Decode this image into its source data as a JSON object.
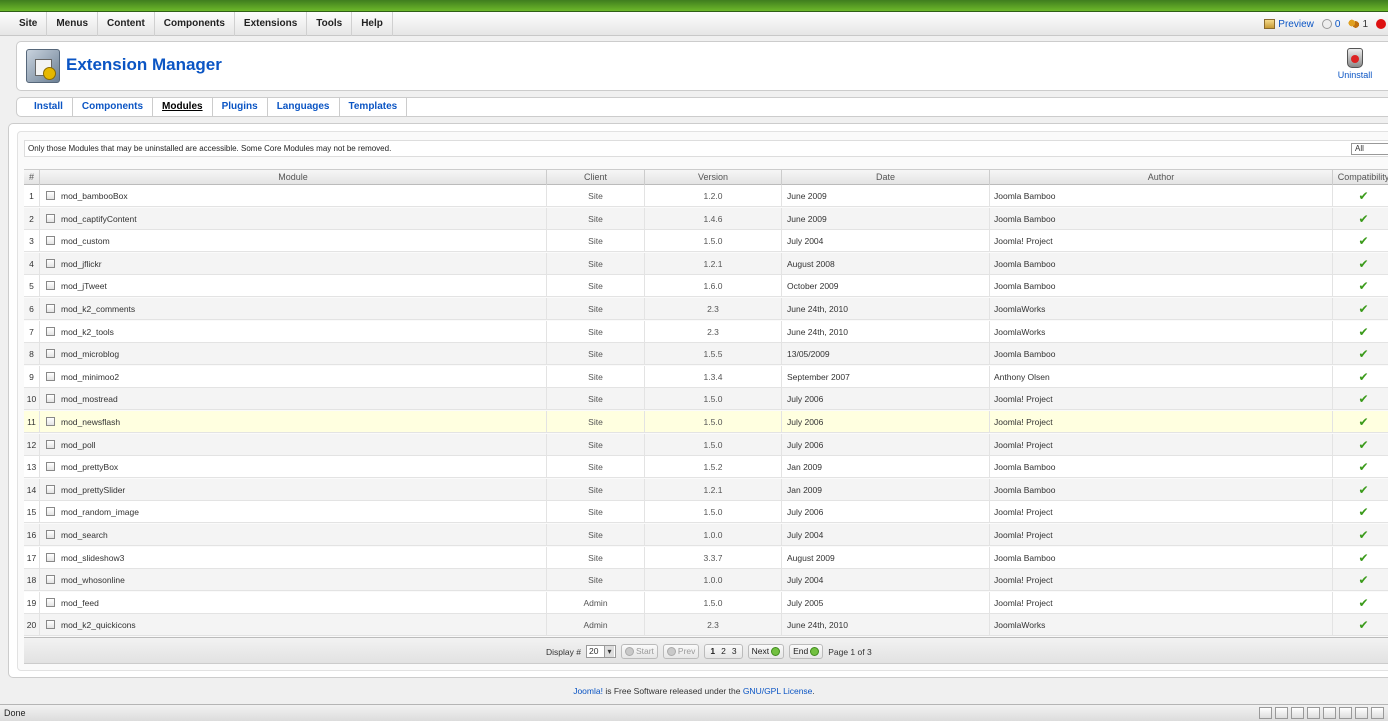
{
  "menu": [
    "Site",
    "Menus",
    "Content",
    "Components",
    "Extensions",
    "Tools",
    "Help"
  ],
  "status": {
    "preview": "Preview",
    "messages": "0",
    "users": "1"
  },
  "page_title": "Extension Manager",
  "toolbar": {
    "uninstall": "Uninstall"
  },
  "submenu": [
    "Install",
    "Components",
    "Modules",
    "Plugins",
    "Languages",
    "Templates"
  ],
  "active_submenu": "Modules",
  "notice": "Only those Modules that may be uninstalled are accessible. Some Core Modules may not be removed.",
  "filter": {
    "value": "All"
  },
  "table": {
    "columns": [
      "#",
      "Module",
      "Client",
      "Version",
      "Date",
      "Author",
      "Compatibility"
    ],
    "rows": [
      {
        "num": "1",
        "module": "mod_bambooBox",
        "client": "Site",
        "version": "1.2.0",
        "date": "June 2009",
        "author": "Joomla Bamboo"
      },
      {
        "num": "2",
        "module": "mod_captifyContent",
        "client": "Site",
        "version": "1.4.6",
        "date": "June 2009",
        "author": "Joomla Bamboo"
      },
      {
        "num": "3",
        "module": "mod_custom",
        "client": "Site",
        "version": "1.5.0",
        "date": "July 2004",
        "author": "Joomla! Project"
      },
      {
        "num": "4",
        "module": "mod_jflickr",
        "client": "Site",
        "version": "1.2.1",
        "date": "August 2008",
        "author": "Joomla Bamboo"
      },
      {
        "num": "5",
        "module": "mod_jTweet",
        "client": "Site",
        "version": "1.6.0",
        "date": "October 2009",
        "author": "Joomla Bamboo"
      },
      {
        "num": "6",
        "module": "mod_k2_comments",
        "client": "Site",
        "version": "2.3",
        "date": "June 24th, 2010",
        "author": "JoomlaWorks"
      },
      {
        "num": "7",
        "module": "mod_k2_tools",
        "client": "Site",
        "version": "2.3",
        "date": "June 24th, 2010",
        "author": "JoomlaWorks"
      },
      {
        "num": "8",
        "module": "mod_microblog",
        "client": "Site",
        "version": "1.5.5",
        "date": "13/05/2009",
        "author": "Joomla Bamboo"
      },
      {
        "num": "9",
        "module": "mod_minimoo2",
        "client": "Site",
        "version": "1.3.4",
        "date": "September 2007",
        "author": "Anthony Olsen"
      },
      {
        "num": "10",
        "module": "mod_mostread",
        "client": "Site",
        "version": "1.5.0",
        "date": "July 2006",
        "author": "Joomla! Project"
      },
      {
        "num": "11",
        "module": "mod_newsflash",
        "client": "Site",
        "version": "1.5.0",
        "date": "July 2006",
        "author": "Joomla! Project"
      },
      {
        "num": "12",
        "module": "mod_poll",
        "client": "Site",
        "version": "1.5.0",
        "date": "July 2006",
        "author": "Joomla! Project"
      },
      {
        "num": "13",
        "module": "mod_prettyBox",
        "client": "Site",
        "version": "1.5.2",
        "date": "Jan 2009",
        "author": "Joomla Bamboo"
      },
      {
        "num": "14",
        "module": "mod_prettySlider",
        "client": "Site",
        "version": "1.2.1",
        "date": "Jan 2009",
        "author": "Joomla Bamboo"
      },
      {
        "num": "15",
        "module": "mod_random_image",
        "client": "Site",
        "version": "1.5.0",
        "date": "July 2006",
        "author": "Joomla! Project"
      },
      {
        "num": "16",
        "module": "mod_search",
        "client": "Site",
        "version": "1.0.0",
        "date": "July 2004",
        "author": "Joomla! Project"
      },
      {
        "num": "17",
        "module": "mod_slideshow3",
        "client": "Site",
        "version": "3.3.7",
        "date": "August 2009",
        "author": "Joomla Bamboo"
      },
      {
        "num": "18",
        "module": "mod_whosonline",
        "client": "Site",
        "version": "1.0.0",
        "date": "July 2004",
        "author": "Joomla! Project"
      },
      {
        "num": "19",
        "module": "mod_feed",
        "client": "Admin",
        "version": "1.5.0",
        "date": "July 2005",
        "author": "Joomla! Project"
      },
      {
        "num": "20",
        "module": "mod_k2_quickicons",
        "client": "Admin",
        "version": "2.3",
        "date": "June 24th, 2010",
        "author": "JoomlaWorks"
      }
    ]
  },
  "pagination": {
    "display_label": "Display #",
    "display_value": "20",
    "start": "Start",
    "prev": "Prev",
    "pages": [
      "1",
      "2",
      "3"
    ],
    "next": "Next",
    "end": "End",
    "page_info": "Page 1 of 3"
  },
  "footer": {
    "joomla": "Joomla!",
    "middle": " is Free Software released under the ",
    "license": "GNU/GPL License",
    "end": "."
  },
  "browser_status": "Done",
  "colors": {
    "brand_green": "#6cb82a",
    "link_blue": "#0b55c4",
    "highlight_row": "#ffffe0",
    "check_green": "#3a9a1a"
  }
}
